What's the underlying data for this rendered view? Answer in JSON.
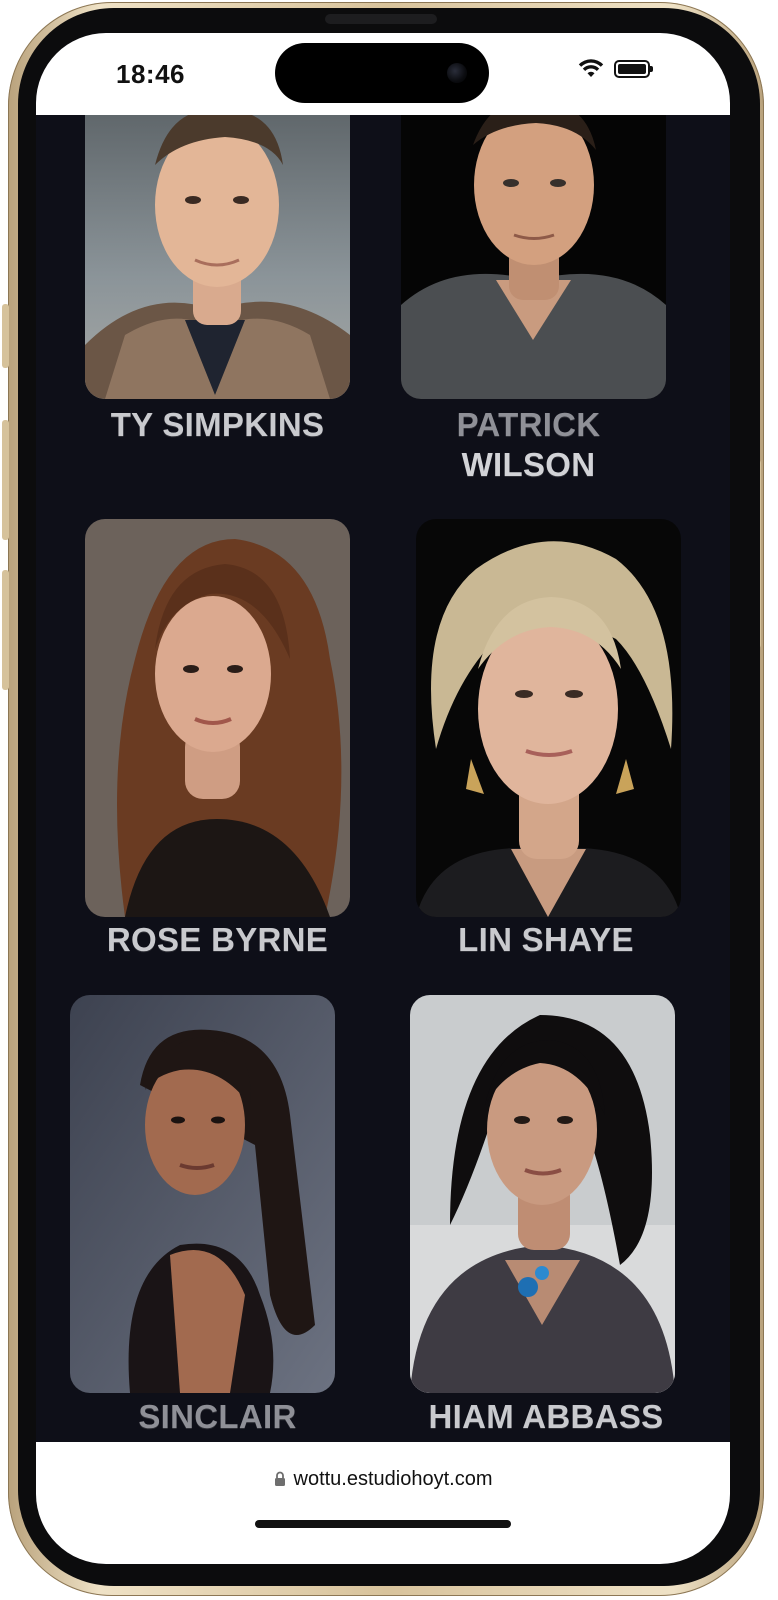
{
  "status_bar": {
    "time": "18:46"
  },
  "browser": {
    "url": "wottu.estudiohoyt.com"
  },
  "cast": [
    {
      "name": "TY SIMPKINS",
      "photo_icon": "person-portrait-icon"
    },
    {
      "name_line1": "PATRICK",
      "name_line2": "WILSON",
      "photo_icon": "person-portrait-icon"
    },
    {
      "name": "ROSE BYRNE",
      "photo_icon": "person-portrait-icon"
    },
    {
      "name": "LIN SHAYE",
      "photo_icon": "person-portrait-icon"
    },
    {
      "name": "SINCLAIR",
      "photo_icon": "person-portrait-icon"
    },
    {
      "name": "HIAM ABBASS",
      "photo_icon": "person-portrait-icon"
    }
  ],
  "colors": {
    "page_background": "#0e0f18",
    "name_text": "#c9cace",
    "frame_gold": "#d8c39c"
  }
}
